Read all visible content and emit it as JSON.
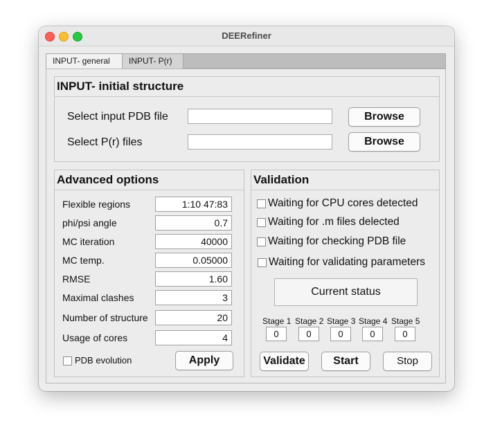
{
  "window": {
    "title": "DEERefiner"
  },
  "tabs": [
    {
      "label": "INPUT- general",
      "active": true
    },
    {
      "label": "INPUT- P(r)",
      "active": false
    }
  ],
  "input_panel": {
    "title": "INPUT- initial structure",
    "pdb_label": "Select input PDB file",
    "pdb_value": "",
    "pr_label": "Select P(r) files",
    "pr_value": "",
    "browse_label": "Browse"
  },
  "advanced": {
    "title": "Advanced options",
    "fields": [
      {
        "label": "Flexible regions",
        "value": "1:10 47:83"
      },
      {
        "label": "phi/psi angle",
        "value": "0.7"
      },
      {
        "label": "MC iteration",
        "value": "40000"
      },
      {
        "label": "MC temp.",
        "value": "0.05000"
      },
      {
        "label": "RMSE",
        "value": "1.60"
      },
      {
        "label": "Maximal clashes",
        "value": "3"
      },
      {
        "label": "Number of structure",
        "value": "20"
      },
      {
        "label": "Usage of cores",
        "value": "4"
      }
    ],
    "pdb_evolution_label": "PDB evolution",
    "pdb_evolution_checked": false,
    "apply_label": "Apply"
  },
  "validation": {
    "title": "Validation",
    "checks": [
      {
        "label": "Waiting for CPU cores detected",
        "checked": false
      },
      {
        "label": "Waiting for .m files delected",
        "checked": false
      },
      {
        "label": "Waiting for checking PDB file",
        "checked": false
      },
      {
        "label": "Waiting for validating parameters",
        "checked": false
      }
    ],
    "status_label": "Current status",
    "stages": [
      {
        "label": "Stage 1",
        "value": "0"
      },
      {
        "label": "Stage 2",
        "value": "0"
      },
      {
        "label": "Stage 3",
        "value": "0"
      },
      {
        "label": "Stage 4",
        "value": "0"
      },
      {
        "label": "Stage 5",
        "value": "0"
      }
    ],
    "validate_label": "Validate",
    "start_label": "Start",
    "stop_label": "Stop"
  }
}
